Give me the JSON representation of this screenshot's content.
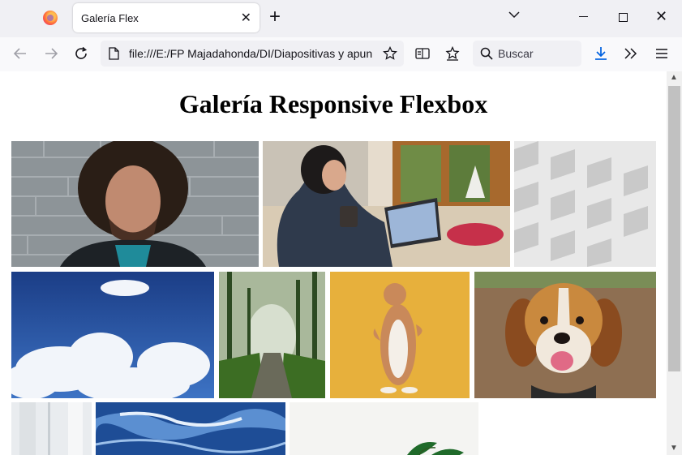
{
  "tab": {
    "title": "Galería Flex"
  },
  "toolbar": {
    "url": "file:///E:/FP Majadahonda/DI/Diapositivas y apuntes",
    "search_placeholder": "Buscar"
  },
  "page": {
    "heading": "Galería Responsive Flexbox",
    "images": [
      {
        "name": "curly-haired-man"
      },
      {
        "name": "woman-with-laptop"
      },
      {
        "name": "white-building-facade"
      },
      {
        "name": "sky-clouds"
      },
      {
        "name": "misty-forest-path"
      },
      {
        "name": "cat-standing"
      },
      {
        "name": "beagle-dog"
      },
      {
        "name": "white-architecture"
      },
      {
        "name": "ocean-waves"
      },
      {
        "name": "plant-leaves"
      }
    ]
  },
  "colors": {
    "accent": "#0061e0",
    "tab_bg": "#ffffff",
    "chrome_bg": "#f0f0f4"
  }
}
